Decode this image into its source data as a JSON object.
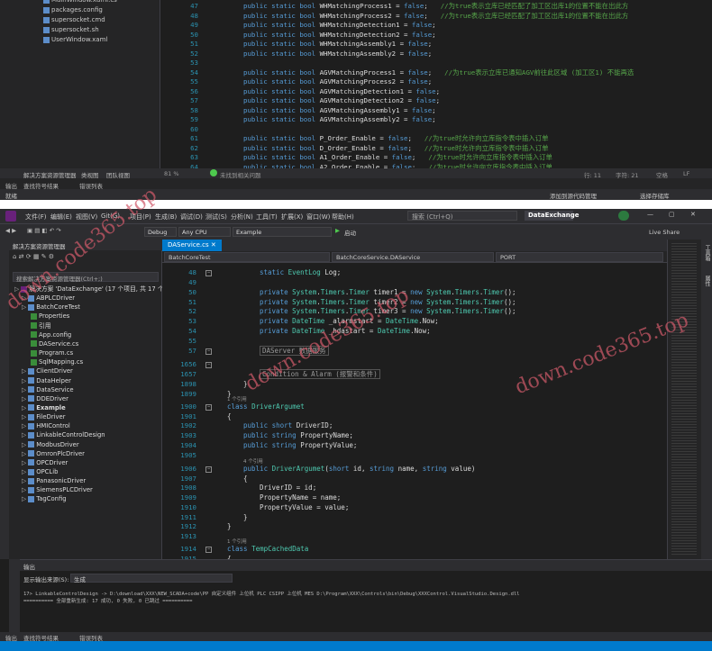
{
  "top_window": {
    "solution_files": [
      "MainWindow.xaml.cs",
      "packages.config",
      "supersocket.cmd",
      "supersocket.sh",
      "UserWindow.xaml"
    ],
    "lines": [
      {
        "n": "47",
        "code": "public static bool WHMatchingProcess1 = false;",
        "comment": "//为true表示立库已经匹配了加工区出库1的位置不能在出此方"
      },
      {
        "n": "48",
        "code": "public static bool WHMatchingProcess2 = false;",
        "comment": "//为true表示立库已经匹配了加工区出库1的位置不能在出此方"
      },
      {
        "n": "49",
        "code": "public static bool WHMatchingDetection1 = false;",
        "comment": ""
      },
      {
        "n": "50",
        "code": "public static bool WHMatchingDetection2 = false;",
        "comment": ""
      },
      {
        "n": "51",
        "code": "public static bool WHMatchingAssembly1 = false;",
        "comment": ""
      },
      {
        "n": "52",
        "code": "public static bool WHMatchingAssembly2 = false;",
        "comment": ""
      },
      {
        "n": "53",
        "code": "",
        "comment": ""
      },
      {
        "n": "54",
        "code": "public static bool AGVMatchingProcess1 = false;",
        "comment": "//为true表示立库已通知AGV前往此区域 (加工区1) 不能再选"
      },
      {
        "n": "55",
        "code": "public static bool AGVMatchingProcess2 = false;",
        "comment": ""
      },
      {
        "n": "56",
        "code": "public static bool AGVMatchingDetection1 = false;",
        "comment": ""
      },
      {
        "n": "57",
        "code": "public static bool AGVMatchingDetection2 = false;",
        "comment": ""
      },
      {
        "n": "58",
        "code": "public static bool AGVMatchingAssembly1 = false;",
        "comment": ""
      },
      {
        "n": "59",
        "code": "public static bool AGVMatchingAssembly2 = false;",
        "comment": ""
      },
      {
        "n": "60",
        "code": "",
        "comment": ""
      },
      {
        "n": "61",
        "code": "public static bool P_Order_Enable = false;",
        "comment": "//为true时允许向立库指令表中插入订单"
      },
      {
        "n": "62",
        "code": "public static bool D_Order_Enable = false;",
        "comment": "//为true时允许向立库指令表中插入订单"
      },
      {
        "n": "63",
        "code": "public static bool A1_Order_Enable = false;",
        "comment": "//为true时允许向立库指令表中插入订单"
      },
      {
        "n": "64",
        "code": "public static bool A2_Order_Enable = false;",
        "comment": "//为true时允许向立库指令表中插入订单"
      }
    ],
    "se_tabs": [
      "解决方案资源管理器",
      "类视图",
      "团队视图"
    ],
    "status_left": "81 %",
    "status_issue": "未找到相关问题",
    "status_right": [
      "行: 11",
      "字符: 21",
      "空格",
      "LF"
    ],
    "output_tabs": [
      "输出",
      "查找符号结果",
      "错误列表"
    ],
    "taskbar_left": "就绪",
    "taskbar_right": [
      "添加到源代码管理",
      "选择存储库"
    ]
  },
  "menu": [
    "文件(F)",
    "编辑(E)",
    "视图(V)",
    "Git(G)",
    "项目(P)",
    "生成(B)",
    "调试(D)",
    "测试(S)",
    "分析(N)",
    "工具(T)",
    "扩展(X)",
    "窗口(W)",
    "帮助(H)"
  ],
  "search_placeholder": "搜索 (Ctrl+Q)",
  "solution_name": "DataExchange",
  "toolbar": {
    "config": "Debug",
    "platform": "Any CPU",
    "project": "Example",
    "start": "启动",
    "live_share": "Live Share"
  },
  "se": {
    "title": "解决方案资源管理器",
    "search": "搜索解决方案资源管理器(Ctrl+;)",
    "rows": [
      {
        "label": "解决方案 'DataExchange' (17 个项目, 共 17 个)",
        "indent": 0,
        "bold": false
      },
      {
        "label": "ABPLCDriver",
        "indent": 1,
        "bold": false
      },
      {
        "label": "BatchCoreTest",
        "indent": 1,
        "bold": false
      },
      {
        "label": "Properties",
        "indent": 2,
        "bold": false
      },
      {
        "label": "引用",
        "indent": 2,
        "bold": false
      },
      {
        "label": "App.config",
        "indent": 2,
        "bold": false
      },
      {
        "label": "DAService.cs",
        "indent": 2,
        "bold": false
      },
      {
        "label": "Program.cs",
        "indent": 2,
        "bold": false
      },
      {
        "label": "SqlMapping.cs",
        "indent": 2,
        "bold": false
      },
      {
        "label": "ClientDriver",
        "indent": 1,
        "bold": false
      },
      {
        "label": "DataHelper",
        "indent": 1,
        "bold": false
      },
      {
        "label": "DataService",
        "indent": 1,
        "bold": false
      },
      {
        "label": "DDEDriver",
        "indent": 1,
        "bold": false
      },
      {
        "label": "Example",
        "indent": 1,
        "bold": true
      },
      {
        "label": "FileDriver",
        "indent": 1,
        "bold": false
      },
      {
        "label": "HMIControl",
        "indent": 1,
        "bold": false
      },
      {
        "label": "LinkableControlDesign",
        "indent": 1,
        "bold": false
      },
      {
        "label": "ModbusDriver",
        "indent": 1,
        "bold": false
      },
      {
        "label": "OmronPlcDriver",
        "indent": 1,
        "bold": false
      },
      {
        "label": "OPCDriver",
        "indent": 1,
        "bold": false
      },
      {
        "label": "OPCLib",
        "indent": 1,
        "bold": false
      },
      {
        "label": "PanasonicDriver",
        "indent": 1,
        "bold": false
      },
      {
        "label": "SiemensPLCDriver",
        "indent": 1,
        "bold": false
      },
      {
        "label": "TagConfig",
        "indent": 1,
        "bold": false
      }
    ]
  },
  "editor": {
    "tab": "DAService.cs",
    "nav": [
      "BatchCoreTest",
      "BatchCoreService.DAService",
      "PORT"
    ],
    "lines": [
      {
        "n": "48",
        "t": "static EventLog Log;"
      },
      {
        "n": "49",
        "t": ""
      },
      {
        "n": "50",
        "t": "private System.Timers.Timer timer1 = new System.Timers.Timer();"
      },
      {
        "n": "51",
        "t": "private System.Timers.Timer timer2 = new System.Timers.Timer();"
      },
      {
        "n": "52",
        "t": "private System.Timers.Timer timer3 = new System.Timers.Timer();"
      },
      {
        "n": "53",
        "t": "private DateTime _alarmstart = DateTime.Now;"
      },
      {
        "n": "54",
        "t": "private DateTime _hdastart = DateTime.Now;"
      },
      {
        "n": "55",
        "t": ""
      },
      {
        "n": "57",
        "t": "DAServer 数据服务"
      },
      {
        "n": "1656",
        "t": ""
      },
      {
        "n": "1657",
        "t": "Condition & Alarm (报警和条件)"
      },
      {
        "n": "1898",
        "t": "}"
      },
      {
        "n": "1899",
        "t": "}"
      },
      {
        "n": "1900",
        "t": "class DriverArgumet"
      },
      {
        "n": "1901",
        "t": "{"
      },
      {
        "n": "1902",
        "t": "public short DriverID;"
      },
      {
        "n": "1903",
        "t": "public string PropertyName;"
      },
      {
        "n": "1904",
        "t": "public string PropertyValue;"
      },
      {
        "n": "1905",
        "t": ""
      },
      {
        "n": "1906",
        "t": "public DriverArgumet(short id, string name, string value)"
      },
      {
        "n": "1907",
        "t": "{"
      },
      {
        "n": "1908",
        "t": "DriverID = id;"
      },
      {
        "n": "1909",
        "t": "PropertyName = name;"
      },
      {
        "n": "1910",
        "t": "PropertyValue = value;"
      },
      {
        "n": "1911",
        "t": "}"
      },
      {
        "n": "1912",
        "t": "}"
      },
      {
        "n": "1913",
        "t": ""
      },
      {
        "n": "1914",
        "t": "class TempCachedData"
      },
      {
        "n": "1915",
        "t": "{"
      }
    ],
    "refs": [
      "1 个引用",
      "4 个引用",
      "1 个引用",
      "1 个引用"
    ]
  },
  "output": {
    "title": "输出",
    "source_label": "显示输出来源(S):",
    "source_value": "生成",
    "lines": [
      "17>  LinkableControlDesign -> D:\\download\\XXX\\NEW_SCADA+code\\PP 自定义组件 上位机 PLC CSIPP 上位机 MES D:\\Program\\XXX\\Controls\\bin\\Debug\\XXXControl.VisualStudio.Design.dll",
      "========== 全部重新生成: 17 成功, 0 失败, 0 已跳过 =========="
    ]
  },
  "bottom_tabs": [
    "输出",
    "查找符号结果",
    "错误列表"
  ],
  "right_strip": [
    "工具箱",
    "属性"
  ],
  "watermarks": [
    "down.code365.top",
    "down.code365.top",
    "down.code365.top"
  ],
  "colors": {
    "accent": "#007acc",
    "keyword": "#569cd6",
    "type": "#4ec9b0",
    "comment": "#57a64a",
    "bg": "#1e1e1e"
  }
}
